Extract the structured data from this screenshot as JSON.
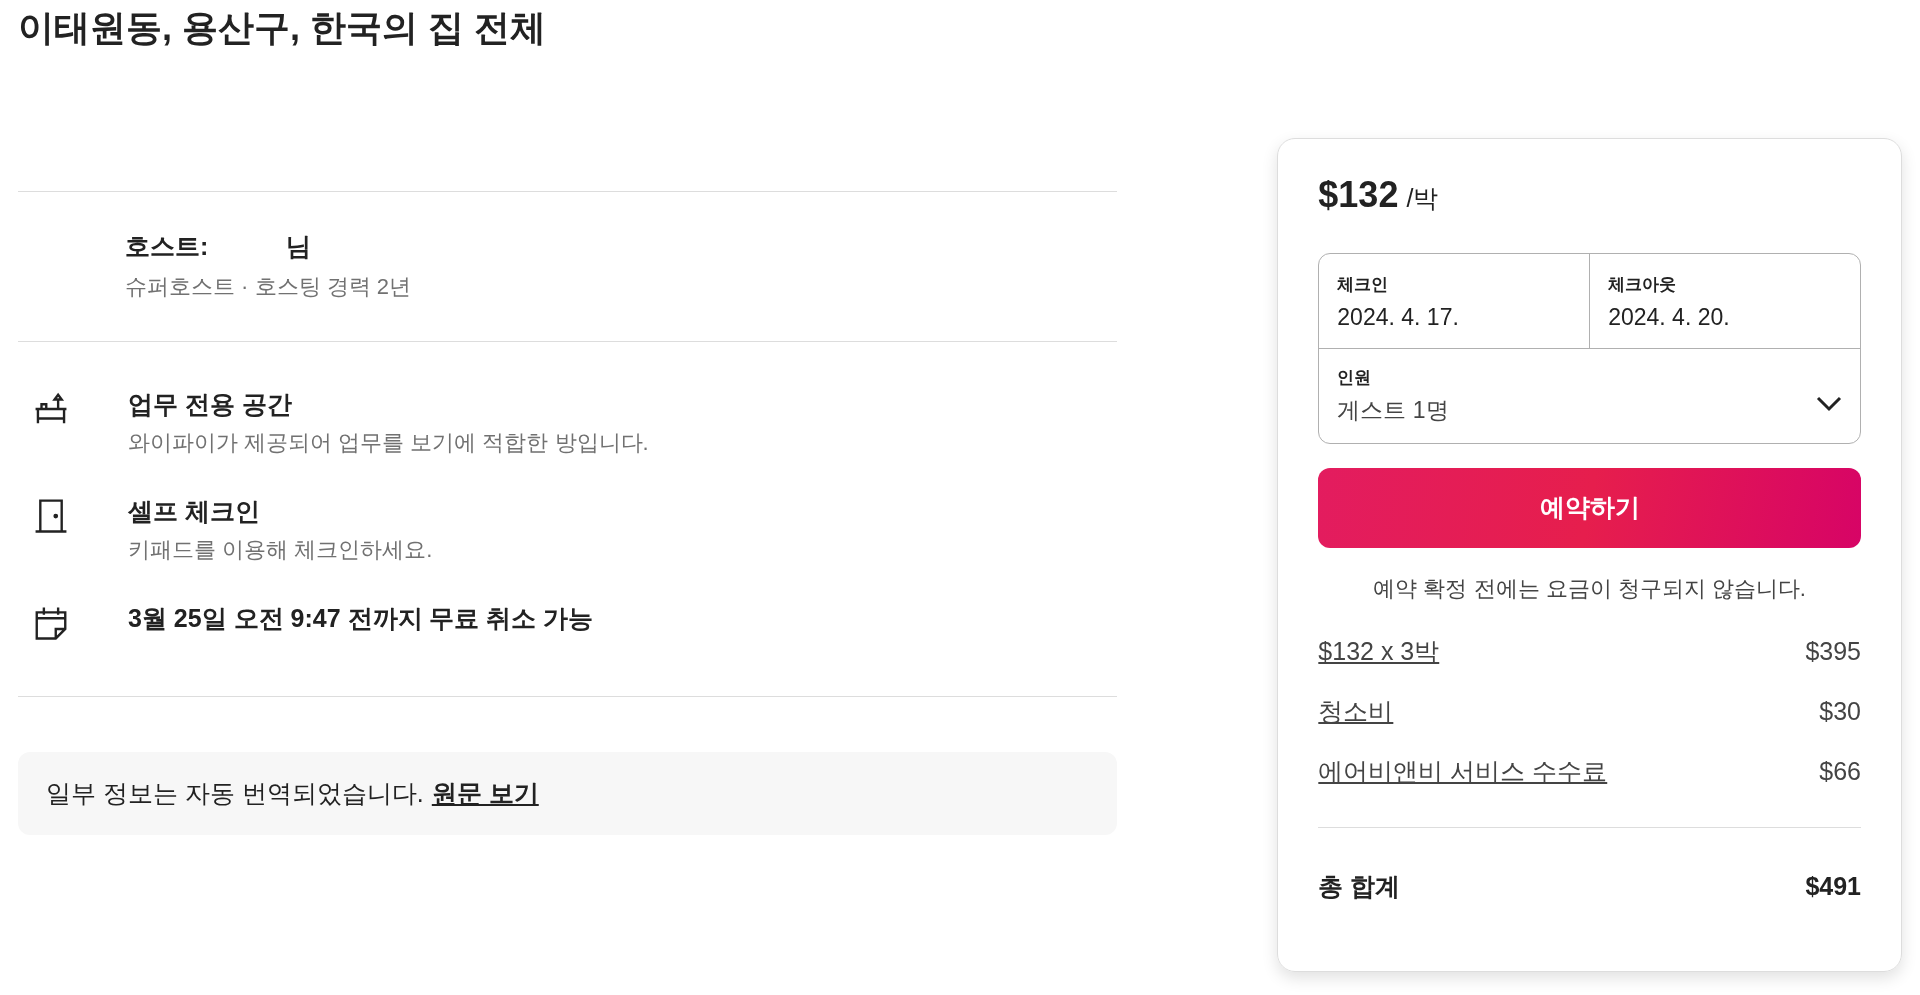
{
  "title": "이태원동, 용산구, 한국의 집 전체",
  "host": {
    "label": "호스트:",
    "suffix": "님",
    "subtitle": "슈퍼호스트 · 호스팅 경력 2년"
  },
  "features": [
    {
      "kind": "desk",
      "title": "업무 전용 공간",
      "description": "와이파이가 제공되어 업무를 보기에 적합한 방입니다."
    },
    {
      "kind": "door",
      "title": "셀프 체크인",
      "description": "키패드를 이용해 체크인하세요."
    },
    {
      "kind": "calendar",
      "title": "3월 25일 오전 9:47 전까지 무료 취소 가능"
    }
  ],
  "translation_notice": {
    "text": "일부 정보는 자동 번역되었습니다.",
    "link": "원문 보기"
  },
  "booking": {
    "price": "$132",
    "unit": "/박",
    "checkin": {
      "label": "체크인",
      "value": "2024. 4. 17."
    },
    "checkout": {
      "label": "체크아웃",
      "value": "2024. 4. 20."
    },
    "guests": {
      "label": "인원",
      "value": "게스트 1명"
    },
    "button": "예약하기",
    "note": "예약 확정 전에는 요금이 청구되지 않습니다.",
    "fees": [
      {
        "label": "$132 x 3박",
        "amount": "$395"
      },
      {
        "label": "청소비",
        "amount": "$30"
      },
      {
        "label": "에어비앤비 서비스 수수료",
        "amount": "$66"
      }
    ],
    "total": {
      "label": "총 합계",
      "amount": "$491"
    }
  }
}
